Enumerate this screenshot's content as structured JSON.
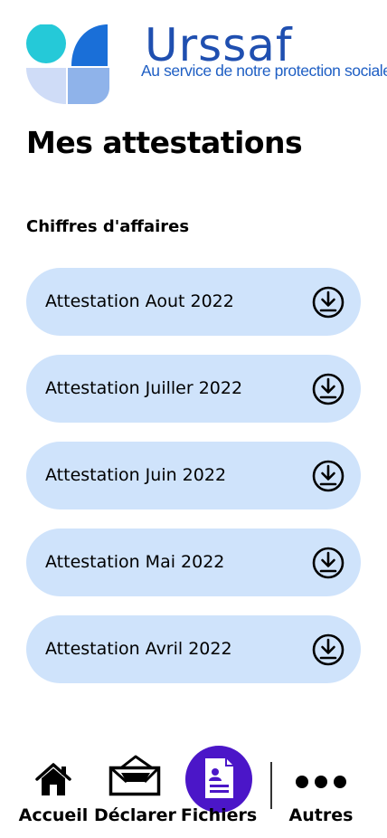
{
  "brand": {
    "name": "Urssaf",
    "tagline": "Au service de notre protection sociale",
    "colors": {
      "primary": "#1f4fb0",
      "teal": "#2bc6d6",
      "blue": "#1a6fd8"
    }
  },
  "page": {
    "title": "Mes attestations",
    "section_title": "Chiffres d'affaires"
  },
  "attestations": [
    {
      "label": "Attestation Aout 2022",
      "icon": "download-icon"
    },
    {
      "label": "Attestation Juiller 2022",
      "icon": "download-icon"
    },
    {
      "label": "Attestation Juin 2022",
      "icon": "download-icon"
    },
    {
      "label": "Attestation Mai 2022",
      "icon": "download-icon"
    },
    {
      "label": "Attestation Avril 2022",
      "icon": "download-icon"
    }
  ],
  "nav": {
    "items": [
      {
        "label": "Accueil",
        "icon": "home-icon",
        "active": false
      },
      {
        "label": "Déclarer",
        "icon": "envelope-icon",
        "active": false
      },
      {
        "label": "Fichiers",
        "icon": "document-icon",
        "active": true
      },
      {
        "label": "Autres",
        "icon": "more-icon",
        "active": false
      }
    ],
    "active_color": "#4b16c8"
  },
  "colors": {
    "card_background": "#cfe3fb"
  }
}
